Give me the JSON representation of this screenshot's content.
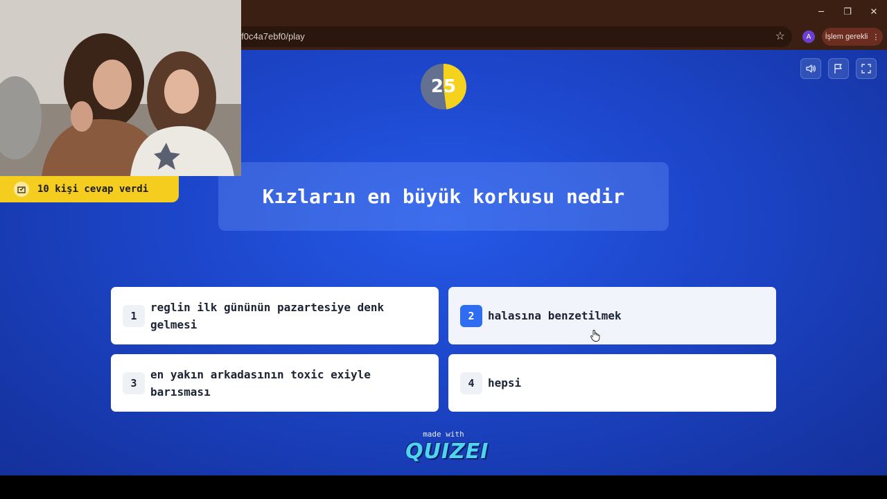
{
  "browser": {
    "url": "f0c4a7ebf0/play",
    "profile_initial": "A",
    "action_label": "İşlem gerekli",
    "window_controls": {
      "minimize": "─",
      "restore": "❐",
      "close": "✕"
    },
    "star_icon": "☆",
    "menu_icon": "⋮"
  },
  "quiz": {
    "timer_value": "25",
    "timer_progress": 0.48,
    "question": "Kızların en büyük korkusu nedir",
    "answers": [
      {
        "number": "1",
        "text": "reglin ilk gününün pazartesiye denk gelmesi"
      },
      {
        "number": "2",
        "text": "halasına benzetilmek"
      },
      {
        "number": "3",
        "text": "en yakın arkadasının toxic exiyle barısması"
      },
      {
        "number": "4",
        "text": "hepsi"
      }
    ],
    "selected_answer": "2",
    "answered_count_label": "10 kişi cevap verdi",
    "made_with_label": "made with",
    "brand": "QUIZEI"
  },
  "colors": {
    "accent_yellow": "#f5cd1f",
    "background_blue": "#1c45c8",
    "selected_blue": "#2f6df0"
  },
  "icons": [
    "volume-icon",
    "flag-icon",
    "fullscreen-icon",
    "vote-box-icon",
    "hand-cursor-icon"
  ]
}
